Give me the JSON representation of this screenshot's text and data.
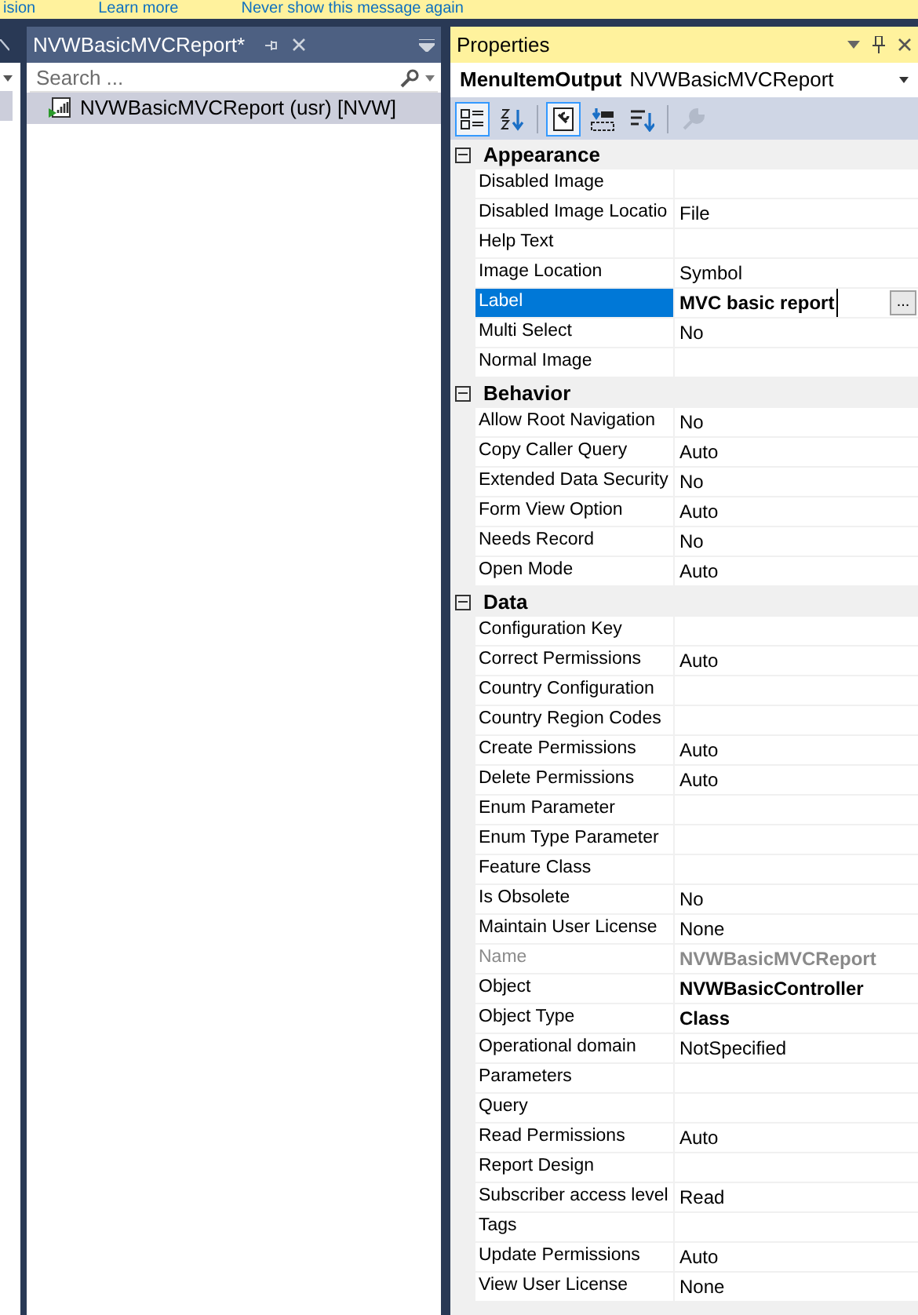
{
  "infobar": {
    "texts": [
      "ision",
      "Learn more",
      "Never show this message again"
    ]
  },
  "explorer": {
    "tab_title": "NVWBasicMVCReport*",
    "search": {
      "placeholder": "Search ..."
    },
    "items": [
      {
        "label": "NVWBasicMVCReport (usr) [NVW]",
        "selected": true
      }
    ]
  },
  "properties": {
    "title": "Properties",
    "object_type": "MenuItemOutput",
    "object_name": "NVWBasicMVCReport",
    "toolbar": [
      {
        "kind": "categorized",
        "selected": true
      },
      {
        "kind": "alphabetical",
        "selected": false
      },
      {
        "kind": "property-pages",
        "selected": true
      },
      {
        "kind": "events",
        "selected": false
      },
      {
        "kind": "sort",
        "selected": false
      },
      {
        "kind": "wrench",
        "selected": false,
        "disabled": true
      }
    ],
    "rows": [
      {
        "kind": "category",
        "name": "Appearance",
        "expanded": true
      },
      {
        "kind": "property",
        "name": "Disabled Image",
        "value": ""
      },
      {
        "kind": "property",
        "name": "Disabled Image Locatio",
        "value": "File"
      },
      {
        "kind": "property",
        "name": "Help Text",
        "value": ""
      },
      {
        "kind": "property",
        "name": "Image Location",
        "value": "Symbol"
      },
      {
        "kind": "property",
        "name": "Label",
        "value": "MVC basic report",
        "selected": true,
        "bold": true,
        "button": "..."
      },
      {
        "kind": "property",
        "name": "Multi Select",
        "value": "No"
      },
      {
        "kind": "property",
        "name": "Normal Image",
        "value": ""
      },
      {
        "kind": "category",
        "name": "Behavior",
        "expanded": true
      },
      {
        "kind": "property",
        "name": "Allow Root Navigation",
        "value": "No"
      },
      {
        "kind": "property",
        "name": "Copy Caller Query",
        "value": "Auto"
      },
      {
        "kind": "property",
        "name": "Extended Data Security",
        "value": "No"
      },
      {
        "kind": "property",
        "name": "Form View Option",
        "value": "Auto"
      },
      {
        "kind": "property",
        "name": "Needs Record",
        "value": "No"
      },
      {
        "kind": "property",
        "name": "Open Mode",
        "value": "Auto"
      },
      {
        "kind": "category",
        "name": "Data",
        "expanded": true
      },
      {
        "kind": "property",
        "name": "Configuration Key",
        "value": ""
      },
      {
        "kind": "property",
        "name": "Correct Permissions",
        "value": "Auto"
      },
      {
        "kind": "property",
        "name": "Country Configuration",
        "value": ""
      },
      {
        "kind": "property",
        "name": "Country Region Codes",
        "value": ""
      },
      {
        "kind": "property",
        "name": "Create Permissions",
        "value": "Auto"
      },
      {
        "kind": "property",
        "name": "Delete Permissions",
        "value": "Auto"
      },
      {
        "kind": "property",
        "name": "Enum Parameter",
        "value": ""
      },
      {
        "kind": "property",
        "name": "Enum Type Parameter",
        "value": ""
      },
      {
        "kind": "property",
        "name": "Feature Class",
        "value": ""
      },
      {
        "kind": "property",
        "name": "Is Obsolete",
        "value": "No"
      },
      {
        "kind": "property",
        "name": "Maintain User License",
        "value": "None"
      },
      {
        "kind": "property",
        "name": "Name",
        "value": "NVWBasicMVCReport",
        "disabled": true,
        "bold": true
      },
      {
        "kind": "property",
        "name": "Object",
        "value": "NVWBasicController",
        "bold": true
      },
      {
        "kind": "property",
        "name": "Object Type",
        "value": "Class",
        "bold": true
      },
      {
        "kind": "property",
        "name": "Operational domain",
        "value": "NotSpecified"
      },
      {
        "kind": "property",
        "name": "Parameters",
        "value": ""
      },
      {
        "kind": "property",
        "name": "Query",
        "value": ""
      },
      {
        "kind": "property",
        "name": "Read Permissions",
        "value": "Auto"
      },
      {
        "kind": "property",
        "name": "Report Design",
        "value": ""
      },
      {
        "kind": "property",
        "name": "Subscriber access level",
        "value": "Read"
      },
      {
        "kind": "property",
        "name": "Tags",
        "value": ""
      },
      {
        "kind": "property",
        "name": "Update Permissions",
        "value": "Auto"
      },
      {
        "kind": "property",
        "name": "View User License",
        "value": "None"
      }
    ]
  }
}
